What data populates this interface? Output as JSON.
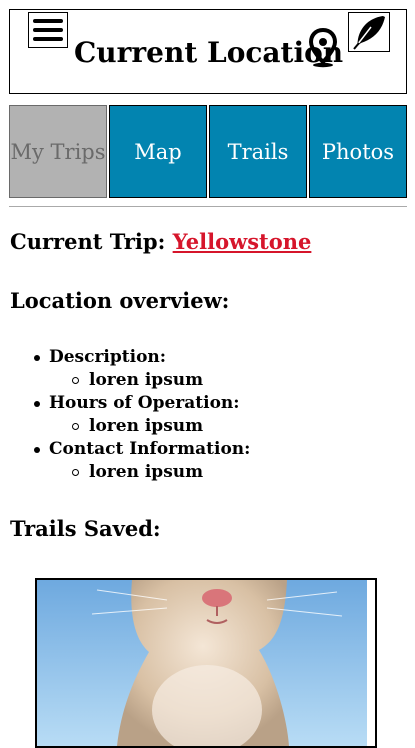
{
  "header": {
    "title": "Current Location"
  },
  "tabs": [
    {
      "label": "My Trips"
    },
    {
      "label": "Map"
    },
    {
      "label": "Trails"
    },
    {
      "label": "Photos"
    }
  ],
  "trip": {
    "label": "Current Trip:",
    "name": "Yellowstone"
  },
  "overview": {
    "heading": "Location overview:",
    "items": [
      {
        "label": "Description:",
        "value": "loren ipsum"
      },
      {
        "label": "Hours of Operation:",
        "value": "loren ipsum"
      },
      {
        "label": "Contact Information:",
        "value": "loren ipsum"
      }
    ]
  },
  "trails": {
    "heading": "Trails Saved:"
  },
  "colors": {
    "tab_bg": "#0284b0",
    "tab_active_bg": "#b2b2b2",
    "trip_link": "#d6152b"
  }
}
